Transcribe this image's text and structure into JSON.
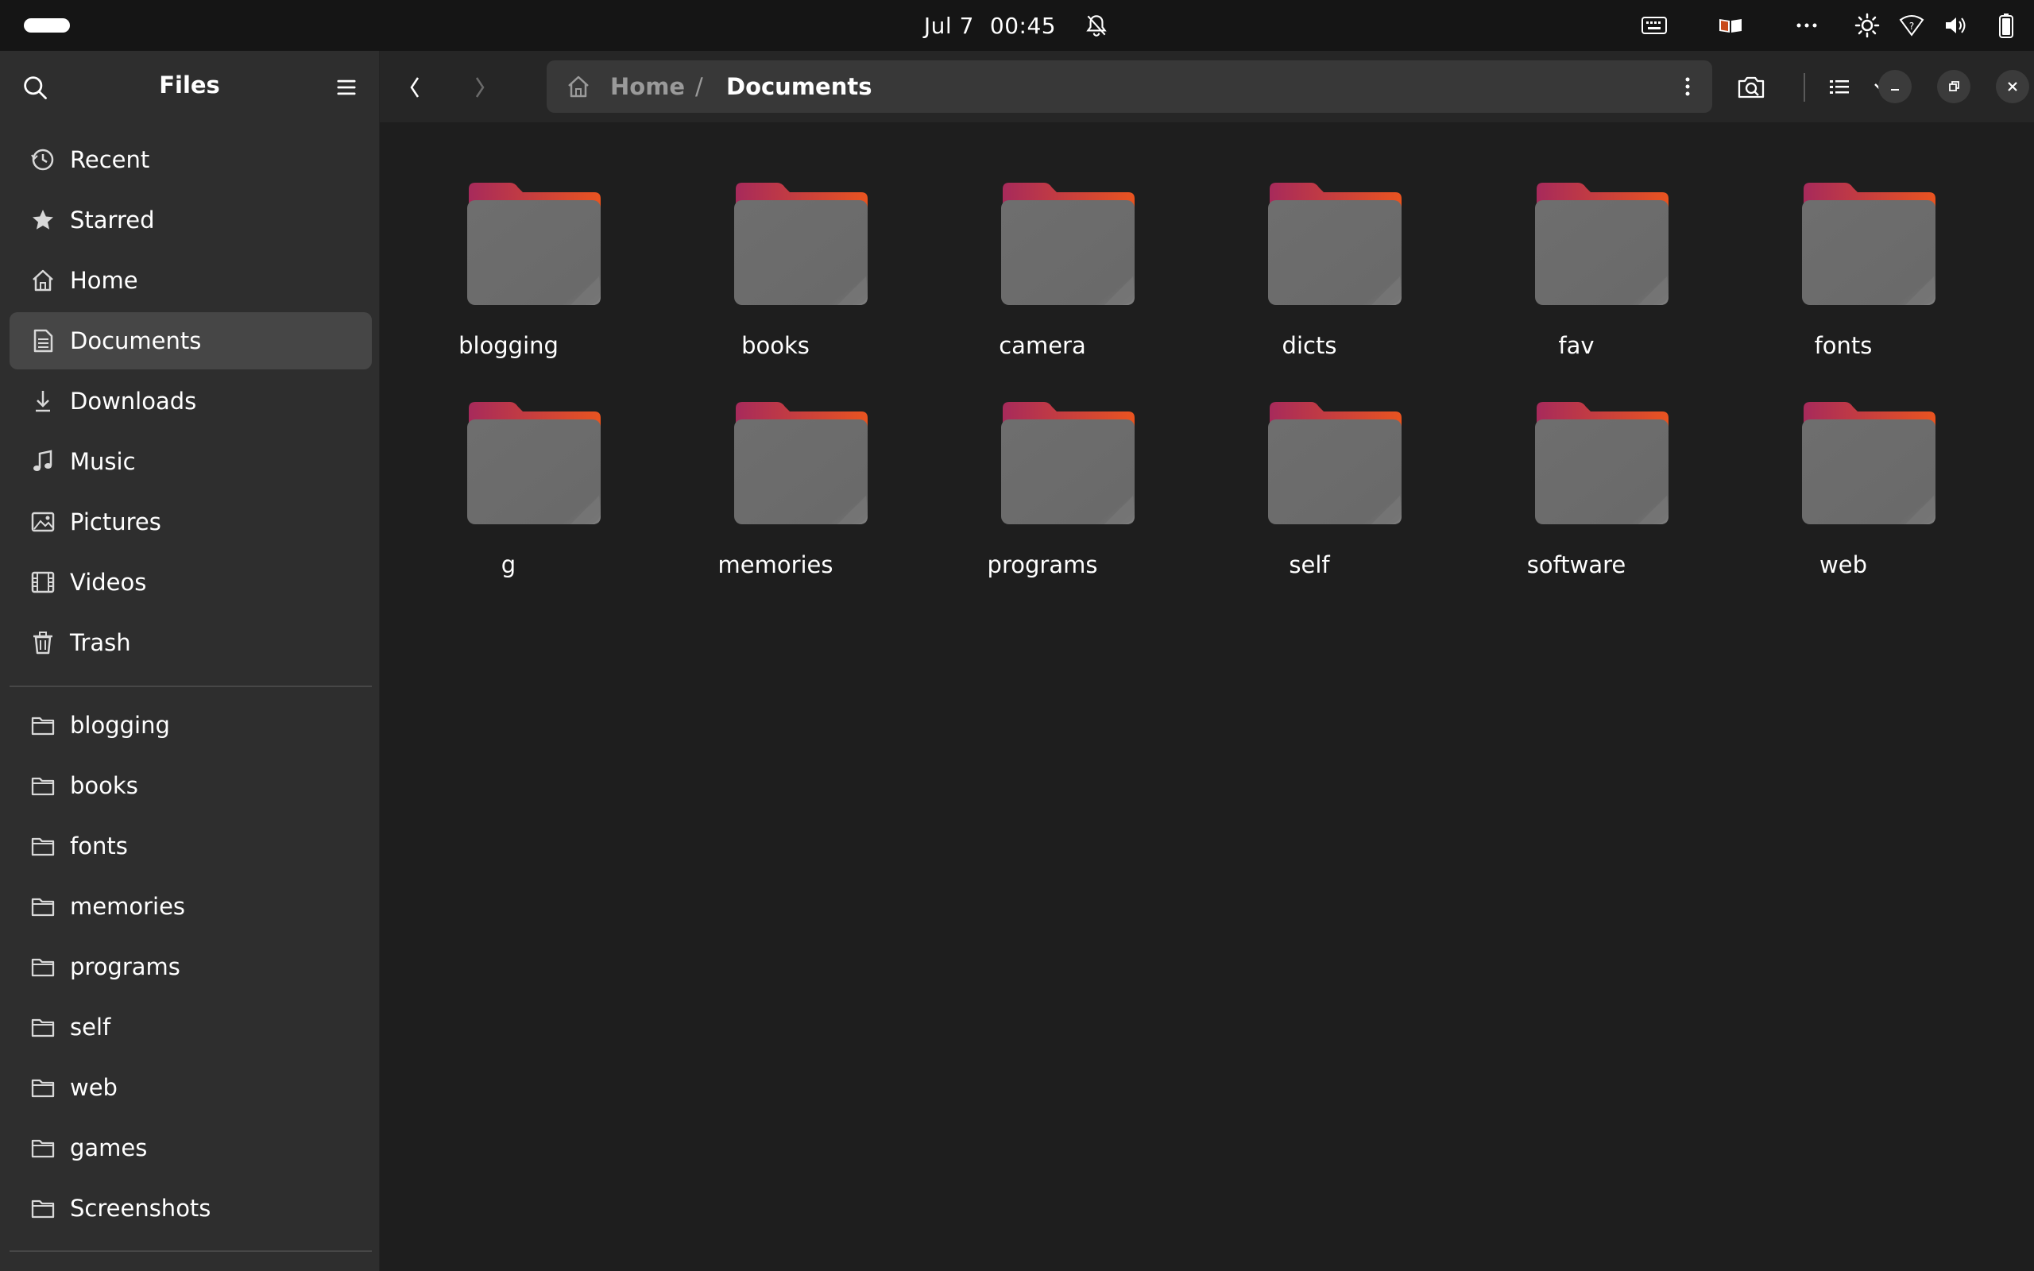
{
  "topbar": {
    "date": "Jul 7",
    "time": "00:45",
    "icons": [
      "keyboard-icon",
      "book-icon",
      "more-icon",
      "brightness-icon",
      "wifi-icon",
      "volume-icon",
      "battery-icon"
    ]
  },
  "sidebar": {
    "title": "Files",
    "places": [
      {
        "label": "Recent",
        "icon": "clock-icon"
      },
      {
        "label": "Starred",
        "icon": "star-icon"
      },
      {
        "label": "Home",
        "icon": "home-icon"
      },
      {
        "label": "Documents",
        "icon": "document-icon",
        "active": true
      },
      {
        "label": "Downloads",
        "icon": "download-icon"
      },
      {
        "label": "Music",
        "icon": "music-icon"
      },
      {
        "label": "Pictures",
        "icon": "picture-icon"
      },
      {
        "label": "Videos",
        "icon": "video-icon"
      },
      {
        "label": "Trash",
        "icon": "trash-icon"
      }
    ],
    "bookmarks": [
      {
        "label": "blogging"
      },
      {
        "label": "books"
      },
      {
        "label": "fonts"
      },
      {
        "label": "memories"
      },
      {
        "label": "programs"
      },
      {
        "label": "self"
      },
      {
        "label": "web"
      },
      {
        "label": "games"
      },
      {
        "label": "Screenshots"
      }
    ]
  },
  "header": {
    "path": [
      {
        "label": "Home"
      },
      {
        "label": "Documents"
      }
    ],
    "separator": "/"
  },
  "folders": [
    {
      "name": "blogging"
    },
    {
      "name": "books"
    },
    {
      "name": "camera"
    },
    {
      "name": "dicts"
    },
    {
      "name": "fav"
    },
    {
      "name": "fonts"
    },
    {
      "name": "g"
    },
    {
      "name": "memories"
    },
    {
      "name": "programs"
    },
    {
      "name": "self"
    },
    {
      "name": "software"
    },
    {
      "name": "web"
    }
  ],
  "colors": {
    "folder_body": "#6c6c6c",
    "folder_tab_start": "#a72a5b",
    "folder_tab_end": "#e95420",
    "sidebar_bg": "#2e2e2e",
    "content_bg": "#1e1e1e"
  }
}
